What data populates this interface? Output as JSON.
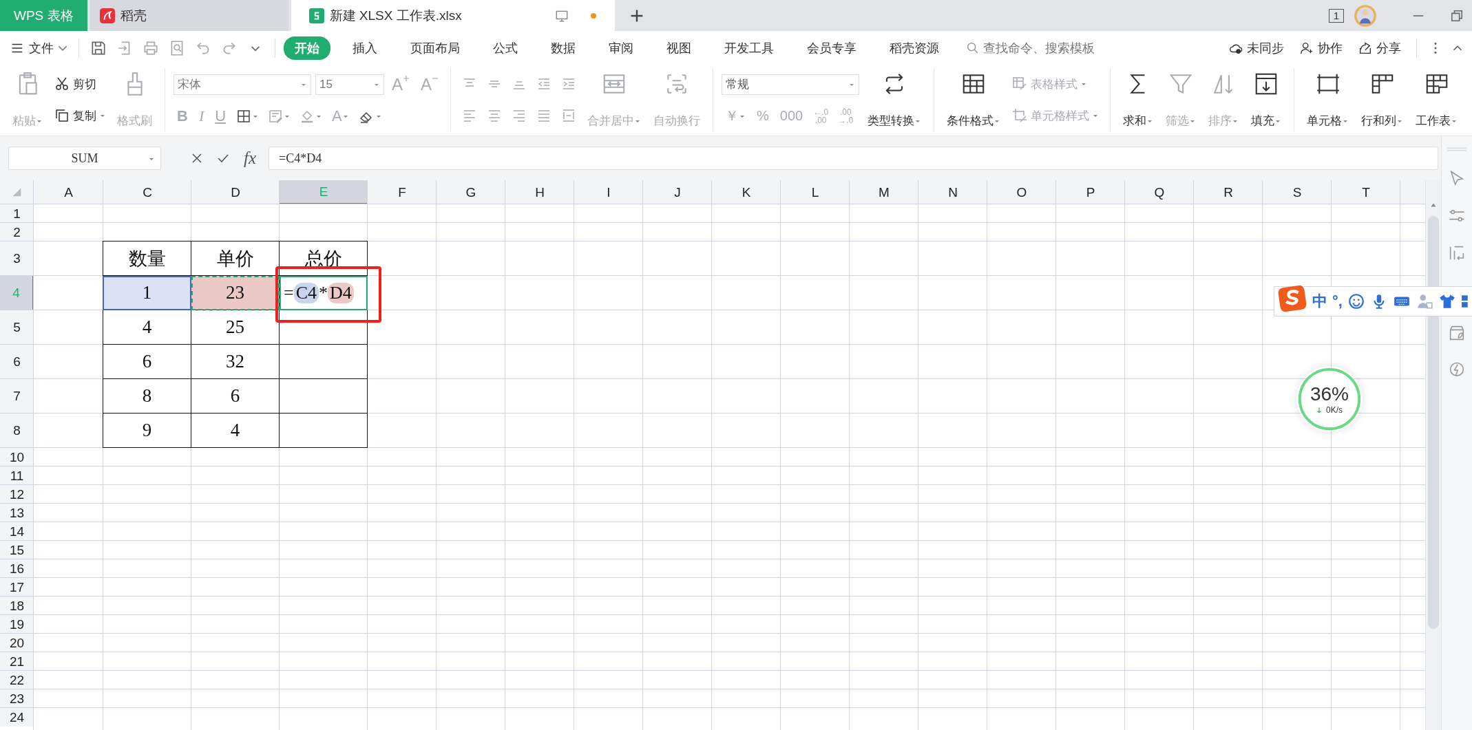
{
  "tabs": [
    {
      "label": "WPS 表格",
      "kind": "home",
      "selected": false,
      "unsaved": false
    },
    {
      "label": "稻壳",
      "kind": "docer",
      "selected": false,
      "unsaved": false
    },
    {
      "label": "新建 XLSX 工作表.xlsx",
      "kind": "sheet",
      "selected": true,
      "unsaved": true
    }
  ],
  "window_badge": "1",
  "menu": {
    "file": "文件",
    "quick": [
      {
        "kind": "save"
      },
      {
        "kind": "export"
      },
      {
        "kind": "print"
      },
      {
        "kind": "preview"
      },
      {
        "kind": "undo"
      },
      {
        "kind": "redo"
      },
      {
        "kind": "more"
      }
    ],
    "tabs": [
      {
        "label": "开始",
        "selected": true
      },
      {
        "label": "插入",
        "selected": false
      },
      {
        "label": "页面布局",
        "selected": false
      },
      {
        "label": "公式",
        "selected": false
      },
      {
        "label": "数据",
        "selected": false
      },
      {
        "label": "审阅",
        "selected": false
      },
      {
        "label": "视图",
        "selected": false
      },
      {
        "label": "开发工具",
        "selected": false
      },
      {
        "label": "会员专享",
        "selected": false
      },
      {
        "label": "稻壳资源",
        "selected": false
      }
    ],
    "search": {
      "placeholder": "查找命令、搜索模板"
    },
    "actions": [
      {
        "kind": "sync",
        "label": "未同步"
      },
      {
        "kind": "collab",
        "label": "协作"
      },
      {
        "kind": "share",
        "label": "分享"
      }
    ]
  },
  "ribbon": [
    {
      "items": [
        {
          "kind": "paste",
          "label": "粘贴",
          "disabled": true,
          "dropdown": true
        },
        {
          "kind": "stack",
          "rows": [
            [
              {
                "kind": "cut",
                "label": "剪切",
                "disabled": false,
                "dropdown": false
              }
            ],
            [
              {
                "kind": "copy",
                "label": "复制",
                "disabled": false,
                "dropdown": true
              }
            ]
          ]
        },
        {
          "kind": "brush",
          "label": "格式刷",
          "disabled": true,
          "dropdown": false
        }
      ]
    },
    {
      "items": [
        {
          "kind": "stack",
          "rows": [
            [
              {
                "kind": "font-field",
                "value": "宋体"
              },
              {
                "kind": "size-field",
                "value": "15"
              },
              {
                "kind": "grow",
                "text": "A",
                "disabled": true
              },
              {
                "kind": "shrink",
                "text": "A",
                "disabled": true
              }
            ],
            [
              {
                "kind": "bold",
                "text": "B",
                "disabled": true
              },
              {
                "kind": "italic",
                "text": "I",
                "disabled": true
              },
              {
                "kind": "underline",
                "text": "U",
                "disabled": true
              },
              {
                "kind": "border",
                "disabled": false,
                "dropdown": true
              },
              {
                "kind": "pattern",
                "disabled": true,
                "dropdown": true
              },
              {
                "kind": "fillcolor",
                "disabled": true,
                "dropdown": true
              },
              {
                "kind": "fontcolor",
                "text": "A",
                "disabled": true,
                "dropdown": true
              },
              {
                "kind": "eraser",
                "disabled": false,
                "dropdown": true
              }
            ]
          ]
        }
      ]
    },
    {
      "items": [
        {
          "kind": "stack",
          "rows": [
            [
              {
                "kind": "align-top",
                "disabled": true
              },
              {
                "kind": "align-middle",
                "disabled": true
              },
              {
                "kind": "align-bottom",
                "disabled": true
              },
              {
                "kind": "outdent",
                "disabled": true
              },
              {
                "kind": "indent",
                "disabled": true
              }
            ],
            [
              {
                "kind": "align-left",
                "disabled": true
              },
              {
                "kind": "align-center",
                "disabled": true
              },
              {
                "kind": "align-right",
                "disabled": true
              },
              {
                "kind": "justify",
                "disabled": true
              },
              {
                "kind": "distribute",
                "disabled": true
              }
            ]
          ]
        },
        {
          "kind": "merge",
          "label": "合并居中",
          "disabled": true,
          "dropdown": true
        },
        {
          "kind": "wrap",
          "label": "自动换行",
          "disabled": true,
          "dropdown": false
        }
      ]
    },
    {
      "items": [
        {
          "kind": "stack",
          "rows": [
            [
              {
                "kind": "format-field",
                "value": "常规"
              }
            ],
            [
              {
                "kind": "currency",
                "text": "￥",
                "disabled": true,
                "dropdown": true
              },
              {
                "kind": "percent",
                "text": "%",
                "disabled": true
              },
              {
                "kind": "thousands",
                "text": "000",
                "disabled": true
              },
              {
                "kind": "decimal",
                "top": "←.0",
                "bottom": ".00",
                "disabled": true
              },
              {
                "kind": "decimal",
                "top": ".00",
                "bottom": "→.0",
                "disabled": true
              }
            ]
          ]
        },
        {
          "kind": "convert",
          "label": "类型转换",
          "disabled": false,
          "dropdown": true
        }
      ]
    },
    {
      "items": [
        {
          "kind": "conditional",
          "label": "条件格式",
          "disabled": false,
          "dropdown": true
        },
        {
          "kind": "stack",
          "rows": [
            [
              {
                "kind": "table-style",
                "label": "表格样式",
                "disabled": true,
                "dropdown": true
              }
            ],
            [
              {
                "kind": "cell-style",
                "label": "单元格样式",
                "disabled": true,
                "dropdown": true
              }
            ]
          ]
        }
      ]
    },
    {
      "items": [
        {
          "kind": "sum",
          "label": "求和",
          "disabled": false,
          "dropdown": true
        },
        {
          "kind": "filter",
          "label": "筛选",
          "disabled": true,
          "dropdown": true
        },
        {
          "kind": "sort",
          "label": "排序",
          "disabled": true,
          "dropdown": true
        },
        {
          "kind": "fill",
          "label": "填充",
          "disabled": false,
          "dropdown": true
        }
      ]
    },
    {
      "items": [
        {
          "kind": "cells",
          "label": "单元格",
          "disabled": false,
          "dropdown": true
        },
        {
          "kind": "rowcol",
          "label": "行和列",
          "disabled": false,
          "dropdown": true
        },
        {
          "kind": "sheet",
          "label": "工作表",
          "disabled": false,
          "dropdown": true
        }
      ]
    }
  ],
  "formula_bar": {
    "name_box": "SUM",
    "fx": "fx",
    "formula": "=C4*D4"
  },
  "columns": [
    {
      "label": "A",
      "selected": false
    },
    {
      "label": "C",
      "selected": false
    },
    {
      "label": "D",
      "selected": false
    },
    {
      "label": "E",
      "selected": true
    },
    {
      "label": "F",
      "selected": false
    },
    {
      "label": "G",
      "selected": false
    },
    {
      "label": "H",
      "selected": false
    },
    {
      "label": "I",
      "selected": false
    },
    {
      "label": "J",
      "selected": false
    },
    {
      "label": "K",
      "selected": false
    },
    {
      "label": "L",
      "selected": false
    },
    {
      "label": "M",
      "selected": false
    },
    {
      "label": "N",
      "selected": false
    },
    {
      "label": "O",
      "selected": false
    },
    {
      "label": "P",
      "selected": false
    },
    {
      "label": "Q",
      "selected": false
    },
    {
      "label": "R",
      "selected": false
    },
    {
      "label": "S",
      "selected": false
    },
    {
      "label": "T",
      "selected": false
    }
  ],
  "rows": [
    {
      "label": "1",
      "selected": false
    },
    {
      "label": "2",
      "selected": false
    },
    {
      "label": "3",
      "selected": false
    },
    {
      "label": "4",
      "selected": true
    },
    {
      "label": "5",
      "selected": false
    },
    {
      "label": "6",
      "selected": false
    },
    {
      "label": "7",
      "selected": false
    },
    {
      "label": "8",
      "selected": false
    },
    {
      "label": "10",
      "selected": false
    },
    {
      "label": "11",
      "selected": false
    },
    {
      "label": "12",
      "selected": false
    },
    {
      "label": "13",
      "selected": false
    },
    {
      "label": "14",
      "selected": false
    },
    {
      "label": "15",
      "selected": false
    },
    {
      "label": "16",
      "selected": false
    },
    {
      "label": "17",
      "selected": false
    },
    {
      "label": "18",
      "selected": false
    },
    {
      "label": "19",
      "selected": false
    },
    {
      "label": "20",
      "selected": false
    },
    {
      "label": "21",
      "selected": false
    },
    {
      "label": "22",
      "selected": false
    },
    {
      "label": "23",
      "selected": false
    },
    {
      "label": "24",
      "selected": false
    }
  ],
  "table": {
    "rows": [
      [
        {
          "kind": "text",
          "text": "数量"
        },
        {
          "kind": "text",
          "text": "单价"
        },
        {
          "kind": "text",
          "text": "总价"
        }
      ],
      [
        {
          "kind": "ref",
          "text": "1",
          "color": "#dce2f4"
        },
        {
          "kind": "marquee",
          "text": "23",
          "color": "#ebc9c7"
        },
        {
          "kind": "formula",
          "marked": true,
          "parts": [
            {
              "text": "="
            },
            {
              "text": "C4",
              "color": "#c9d4ef"
            },
            {
              "text": "*"
            },
            {
              "text": "D4",
              "color": "#ecc9c6"
            }
          ]
        }
      ],
      [
        {
          "kind": "text",
          "text": "4"
        },
        {
          "kind": "text",
          "text": "25"
        },
        {
          "kind": "empty"
        }
      ],
      [
        {
          "kind": "text",
          "text": "6"
        },
        {
          "kind": "text",
          "text": "32"
        },
        {
          "kind": "empty"
        }
      ],
      [
        {
          "kind": "text",
          "text": "8"
        },
        {
          "kind": "text",
          "text": "6"
        },
        {
          "kind": "empty"
        }
      ],
      [
        {
          "kind": "text",
          "text": "9"
        },
        {
          "kind": "text",
          "text": "4"
        },
        {
          "kind": "empty"
        }
      ]
    ]
  },
  "ime_bar": {
    "mode": "中",
    "punct": "°,"
  },
  "speed_widget": {
    "percent": "36%",
    "speed": "0K/s"
  }
}
